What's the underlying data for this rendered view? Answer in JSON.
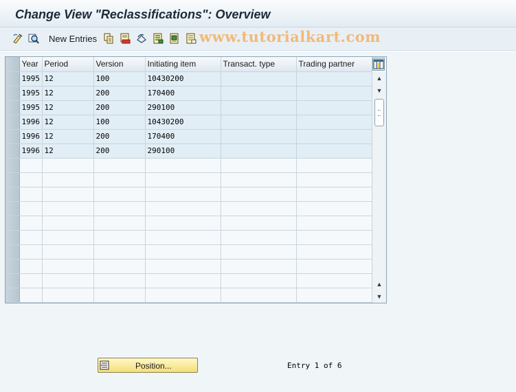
{
  "window": {
    "title": "Change View \"Reclassifications\": Overview"
  },
  "toolbar": {
    "icons": [
      "display-change-icon",
      "details-icon",
      "copy-icon",
      "delete-icon",
      "undo-change-icon",
      "select-all-icon",
      "select-block-icon",
      "deselect-all-icon"
    ],
    "new_entries_label": "New Entries"
  },
  "watermark": {
    "text": "www.tutorialkart.com"
  },
  "table": {
    "columns": [
      "Year",
      "Period",
      "Version",
      "Initiating item",
      "Transact. type",
      "Trading partner"
    ],
    "rows": [
      [
        "1995",
        "12",
        "100",
        "10430200",
        "",
        ""
      ],
      [
        "1995",
        "12",
        "200",
        "170400",
        "",
        ""
      ],
      [
        "1995",
        "12",
        "200",
        "290100",
        "",
        ""
      ],
      [
        "1996",
        "12",
        "100",
        "10430200",
        "",
        ""
      ],
      [
        "1996",
        "12",
        "200",
        "170400",
        "",
        ""
      ],
      [
        "1996",
        "12",
        "200",
        "290100",
        "",
        ""
      ]
    ],
    "empty_rows": 10
  },
  "footer": {
    "position_label": "Position...",
    "entry_info": "Entry 1 of 6"
  },
  "colors": {
    "title_text": "#1c2a38",
    "row_filled": "#e2eef6",
    "row_empty": "#f6f9fb",
    "button_yellow": "#f4de78",
    "watermark": "#f1b97a"
  }
}
